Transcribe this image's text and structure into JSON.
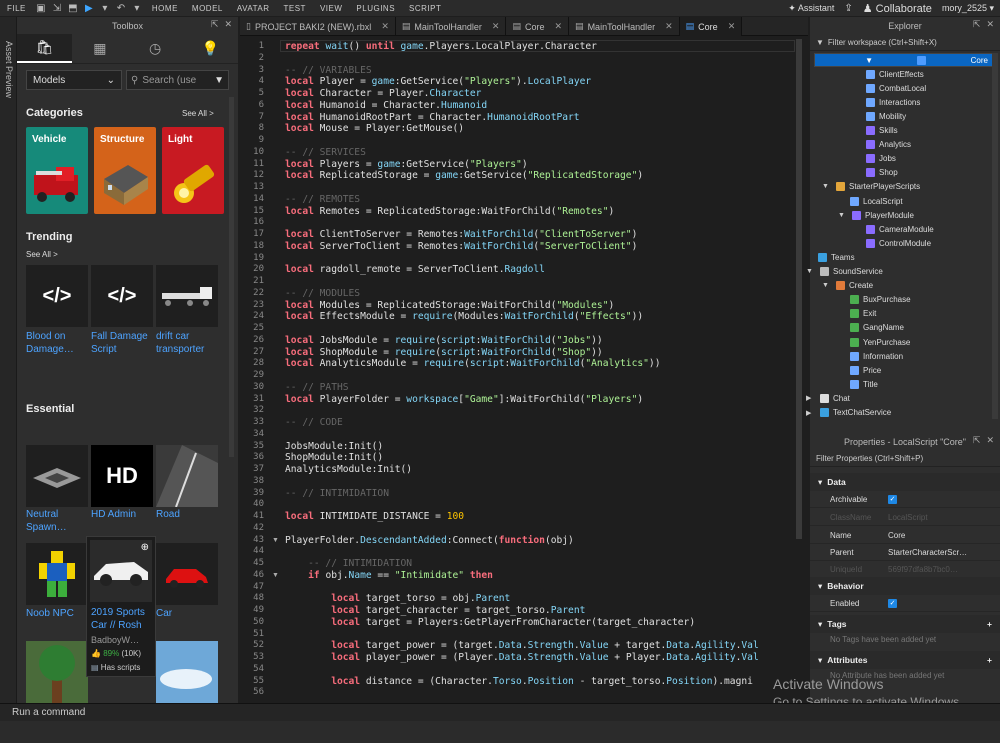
{
  "menubar": {
    "file": "FILE",
    "home": "HOME",
    "model": "MODEL",
    "avatar": "AVATAR",
    "test": "TEST",
    "view": "VIEW",
    "plugins": "PLUGINS",
    "script": "SCRIPT",
    "assistant": "Assistant",
    "collaborate": "Collaborate",
    "username": "mory_2525"
  },
  "toolbox": {
    "title": "Toolbox",
    "asset_preview": "Asset Preview",
    "filter_select": "Models",
    "search_placeholder": "Search (use",
    "categories_heading": "Categories",
    "see_all_categories": "See All >",
    "categories": [
      "Vehicle",
      "Structure",
      "Light"
    ],
    "trending_heading": "Trending",
    "see_all_trending": "See All >",
    "trending": [
      "Blood on Damage…",
      "Fall Damage Script",
      "drift car transporter"
    ],
    "essential_heading": "Essential",
    "essential": [
      "Neutral Spawn…",
      "HD Admin",
      "Road",
      "Noob NPC",
      "",
      "Car"
    ],
    "hd_admin_logo": "HD",
    "tooltip": {
      "name": "2019 Sports Car // Rosh",
      "creator": "BadboyW…",
      "rating": "89%",
      "votes": "(10K)",
      "scripts": "Has scripts"
    }
  },
  "editor": {
    "tabs": [
      {
        "label": "PROJECT BAKI2 (NEW).rbxl",
        "active": false
      },
      {
        "label": "MainToolHandler",
        "active": false
      },
      {
        "label": "Core",
        "active": false
      },
      {
        "label": "MainToolHandler",
        "active": false
      },
      {
        "label": "Core",
        "active": true
      }
    ],
    "lines": [
      {
        "n": "1",
        "t": [
          [
            "k",
            "repeat "
          ],
          [
            "b",
            "wait"
          ],
          [
            "",
            "() "
          ],
          [
            "k",
            "until "
          ],
          [
            "b",
            "game"
          ],
          [
            "",
            ".Players.LocalPlayer.Character"
          ]
        ]
      },
      {
        "n": "2",
        "t": []
      },
      {
        "n": "3",
        "t": [
          [
            "c",
            "-- // VARIABLES"
          ]
        ]
      },
      {
        "n": "4",
        "t": [
          [
            "k",
            "local "
          ],
          [
            "",
            "Player = "
          ],
          [
            "b",
            "game"
          ],
          [
            "",
            ":GetService("
          ],
          [
            "s",
            "\"Players\""
          ],
          [
            "",
            ")."
          ],
          [
            "b",
            "LocalPlayer"
          ]
        ]
      },
      {
        "n": "5",
        "t": [
          [
            "k",
            "local "
          ],
          [
            "",
            "Character = Player."
          ],
          [
            "b",
            "Character"
          ]
        ]
      },
      {
        "n": "6",
        "t": [
          [
            "k",
            "local "
          ],
          [
            "",
            "Humanoid = Character."
          ],
          [
            "b",
            "Humanoid"
          ]
        ]
      },
      {
        "n": "7",
        "t": [
          [
            "k",
            "local "
          ],
          [
            "",
            "HumanoidRootPart = Character."
          ],
          [
            "b",
            "HumanoidRootPart"
          ]
        ]
      },
      {
        "n": "8",
        "t": [
          [
            "k",
            "local "
          ],
          [
            "",
            "Mouse = Player:GetMouse()"
          ]
        ]
      },
      {
        "n": "9",
        "t": []
      },
      {
        "n": "10",
        "t": [
          [
            "c",
            "-- // SERVICES"
          ]
        ]
      },
      {
        "n": "11",
        "t": [
          [
            "k",
            "local "
          ],
          [
            "",
            "Players = "
          ],
          [
            "b",
            "game"
          ],
          [
            "",
            ":GetService("
          ],
          [
            "s",
            "\"Players\""
          ],
          [
            "",
            ")"
          ]
        ]
      },
      {
        "n": "12",
        "t": [
          [
            "k",
            "local "
          ],
          [
            "",
            "ReplicatedStorage = "
          ],
          [
            "b",
            "game"
          ],
          [
            "",
            ":GetService("
          ],
          [
            "s",
            "\"ReplicatedStorage\""
          ],
          [
            "",
            ")"
          ]
        ]
      },
      {
        "n": "13",
        "t": []
      },
      {
        "n": "14",
        "t": [
          [
            "c",
            "-- // REMOTES"
          ]
        ]
      },
      {
        "n": "15",
        "t": [
          [
            "k",
            "local "
          ],
          [
            "",
            "Remotes = ReplicatedStorage:WaitForChild("
          ],
          [
            "s",
            "\"Remotes\""
          ],
          [
            "",
            ")"
          ]
        ]
      },
      {
        "n": "16",
        "t": []
      },
      {
        "n": "17",
        "t": [
          [
            "k",
            "local "
          ],
          [
            "",
            "ClientToServer = Remotes:"
          ],
          [
            "b",
            "WaitForChild"
          ],
          [
            "",
            "("
          ],
          [
            "s",
            "\"ClientToServer\""
          ],
          [
            "",
            ")"
          ]
        ]
      },
      {
        "n": "18",
        "t": [
          [
            "k",
            "local "
          ],
          [
            "",
            "ServerToClient = Remotes:"
          ],
          [
            "b",
            "WaitForChild"
          ],
          [
            "",
            "("
          ],
          [
            "s",
            "\"ServerToClient\""
          ],
          [
            "",
            ")"
          ]
        ]
      },
      {
        "n": "19",
        "t": []
      },
      {
        "n": "20",
        "t": [
          [
            "k",
            "local "
          ],
          [
            "",
            "ragdoll_remote = ServerToClient."
          ],
          [
            "b",
            "Ragdoll"
          ]
        ]
      },
      {
        "n": "21",
        "t": []
      },
      {
        "n": "22",
        "t": [
          [
            "c",
            "-- // MODULES"
          ]
        ]
      },
      {
        "n": "23",
        "t": [
          [
            "k",
            "local "
          ],
          [
            "",
            "Modules = ReplicatedStorage:WaitForChild("
          ],
          [
            "s",
            "\"Modules\""
          ],
          [
            "",
            ")"
          ]
        ]
      },
      {
        "n": "24",
        "t": [
          [
            "k",
            "local "
          ],
          [
            "",
            "EffectsModule = "
          ],
          [
            "b",
            "require"
          ],
          [
            "",
            "(Modules:"
          ],
          [
            "b",
            "WaitForChild"
          ],
          [
            "",
            "("
          ],
          [
            "s",
            "\"Effects\""
          ],
          [
            "",
            "))"
          ]
        ]
      },
      {
        "n": "25",
        "t": []
      },
      {
        "n": "26",
        "t": [
          [
            "k",
            "local "
          ],
          [
            "",
            "JobsModule = "
          ],
          [
            "b",
            "require"
          ],
          [
            "",
            "("
          ],
          [
            "b",
            "script"
          ],
          [
            "",
            ":"
          ],
          [
            "b",
            "WaitForChild"
          ],
          [
            "",
            "("
          ],
          [
            "s",
            "\"Jobs\""
          ],
          [
            "",
            "))"
          ]
        ]
      },
      {
        "n": "27",
        "t": [
          [
            "k",
            "local "
          ],
          [
            "",
            "ShopModule = "
          ],
          [
            "b",
            "require"
          ],
          [
            "",
            "("
          ],
          [
            "b",
            "script"
          ],
          [
            "",
            ":"
          ],
          [
            "b",
            "WaitForChild"
          ],
          [
            "",
            "("
          ],
          [
            "s",
            "\"Shop\""
          ],
          [
            "",
            "))"
          ]
        ]
      },
      {
        "n": "28",
        "t": [
          [
            "k",
            "local "
          ],
          [
            "",
            "AnalyticsModule = "
          ],
          [
            "b",
            "require"
          ],
          [
            "",
            "("
          ],
          [
            "b",
            "script"
          ],
          [
            "",
            ":"
          ],
          [
            "b",
            "WaitForChild"
          ],
          [
            "",
            "("
          ],
          [
            "s",
            "\"Analytics\""
          ],
          [
            "",
            "))"
          ]
        ]
      },
      {
        "n": "29",
        "t": []
      },
      {
        "n": "30",
        "t": [
          [
            "c",
            "-- // PATHS"
          ]
        ]
      },
      {
        "n": "31",
        "t": [
          [
            "k",
            "local "
          ],
          [
            "",
            "PlayerFolder = "
          ],
          [
            "b",
            "workspace"
          ],
          [
            "",
            "["
          ],
          [
            "s",
            "\"Game\""
          ],
          [
            "",
            "]:WaitForChild("
          ],
          [
            "s",
            "\"Players\""
          ],
          [
            "",
            ")"
          ]
        ]
      },
      {
        "n": "32",
        "t": []
      },
      {
        "n": "33",
        "t": [
          [
            "c",
            "-- // CODE"
          ]
        ]
      },
      {
        "n": "34",
        "t": []
      },
      {
        "n": "35",
        "t": [
          [
            "",
            "JobsModule:Init()"
          ]
        ]
      },
      {
        "n": "36",
        "t": [
          [
            "",
            "ShopModule:Init()"
          ]
        ]
      },
      {
        "n": "37",
        "t": [
          [
            "",
            "AnalyticsModule:Init()"
          ]
        ]
      },
      {
        "n": "38",
        "t": []
      },
      {
        "n": "39",
        "t": [
          [
            "c",
            "-- // INTIMIDATION"
          ]
        ]
      },
      {
        "n": "40",
        "t": []
      },
      {
        "n": "41",
        "t": [
          [
            "k",
            "local "
          ],
          [
            "",
            "INTIMIDATE_DISTANCE = "
          ],
          [
            "n",
            "100"
          ]
        ]
      },
      {
        "n": "42",
        "t": []
      },
      {
        "n": "43",
        "t": [
          [
            "",
            "PlayerFolder."
          ],
          [
            "b",
            "DescendantAdded"
          ],
          [
            "",
            ":Connect("
          ],
          [
            "k",
            "function"
          ],
          [
            "",
            "(obj)"
          ]
        ]
      },
      {
        "n": "44",
        "t": []
      },
      {
        "n": "45",
        "t": [
          [
            "c",
            "    -- // INTIMIDATION"
          ]
        ]
      },
      {
        "n": "46",
        "t": [
          [
            "k",
            "    if "
          ],
          [
            "",
            "obj."
          ],
          [
            "b",
            "Name"
          ],
          [
            "",
            " == "
          ],
          [
            "s",
            "\"Intimidate\""
          ],
          [
            "k",
            " then"
          ]
        ]
      },
      {
        "n": "47",
        "t": []
      },
      {
        "n": "48",
        "t": [
          [
            "k",
            "        local "
          ],
          [
            "",
            "target_torso = obj."
          ],
          [
            "b",
            "Parent"
          ]
        ]
      },
      {
        "n": "49",
        "t": [
          [
            "k",
            "        local "
          ],
          [
            "",
            "target_character = target_torso."
          ],
          [
            "b",
            "Parent"
          ]
        ]
      },
      {
        "n": "50",
        "t": [
          [
            "k",
            "        local "
          ],
          [
            "",
            "target = Players:GetPlayerFromCharacter(target_character)"
          ]
        ]
      },
      {
        "n": "51",
        "t": []
      },
      {
        "n": "52",
        "t": [
          [
            "k",
            "        local "
          ],
          [
            "",
            "target_power = (target."
          ],
          [
            "b",
            "Data"
          ],
          [
            "",
            "."
          ],
          [
            "b",
            "Strength"
          ],
          [
            "",
            "."
          ],
          [
            "b",
            "Value"
          ],
          [
            "",
            " + target."
          ],
          [
            "b",
            "Data"
          ],
          [
            "",
            "."
          ],
          [
            "b",
            "Agility"
          ],
          [
            "",
            "."
          ],
          [
            "b",
            "Val"
          ]
        ]
      },
      {
        "n": "53",
        "t": [
          [
            "k",
            "        local "
          ],
          [
            "",
            "player_power = (Player."
          ],
          [
            "b",
            "Data"
          ],
          [
            "",
            "."
          ],
          [
            "b",
            "Strength"
          ],
          [
            "",
            "."
          ],
          [
            "b",
            "Value"
          ],
          [
            "",
            " + Player."
          ],
          [
            "b",
            "Data"
          ],
          [
            "",
            "."
          ],
          [
            "b",
            "Agility"
          ],
          [
            "",
            "."
          ],
          [
            "b",
            "Val"
          ]
        ]
      },
      {
        "n": "54",
        "t": []
      },
      {
        "n": "55",
        "t": [
          [
            "k",
            "        local "
          ],
          [
            "",
            "distance = (Character."
          ],
          [
            "b",
            "Torso"
          ],
          [
            "",
            "."
          ],
          [
            "b",
            "Position"
          ],
          [
            "",
            " - target_torso."
          ],
          [
            "b",
            "Position"
          ],
          [
            "",
            ").magni"
          ]
        ]
      },
      {
        "n": "56",
        "t": []
      }
    ]
  },
  "explorer": {
    "title": "Explorer",
    "filter": "Filter workspace (Ctrl+Shift+X)",
    "items": [
      {
        "label": "Core",
        "depth": 2,
        "color": "#4d9cff",
        "selected": true
      },
      {
        "label": "ClientEffects",
        "depth": 3,
        "color": "#6fa8ff"
      },
      {
        "label": "CombatLocal",
        "depth": 3,
        "color": "#6fa8ff"
      },
      {
        "label": "Interactions",
        "depth": 3,
        "color": "#6fa8ff"
      },
      {
        "label": "Mobility",
        "depth": 3,
        "color": "#6fa8ff"
      },
      {
        "label": "Skills",
        "depth": 3,
        "color": "#8a6cff"
      },
      {
        "label": "Analytics",
        "depth": 3,
        "color": "#8a6cff"
      },
      {
        "label": "Jobs",
        "depth": 3,
        "color": "#8a6cff"
      },
      {
        "label": "Shop",
        "depth": 3,
        "color": "#8a6cff"
      },
      {
        "label": "StarterPlayerScripts",
        "depth": 1,
        "color": "#e3a63b"
      },
      {
        "label": "LocalScript",
        "depth": 2,
        "color": "#6fa8ff"
      },
      {
        "label": "PlayerModule",
        "depth": 2,
        "color": "#8a6cff"
      },
      {
        "label": "CameraModule",
        "depth": 3,
        "color": "#8a6cff"
      },
      {
        "label": "ControlModule",
        "depth": 3,
        "color": "#8a6cff"
      },
      {
        "label": "Teams",
        "depth": 0,
        "color": "#3aa0e0"
      },
      {
        "label": "SoundService",
        "depth": 0,
        "color": "#bbbbbb"
      },
      {
        "label": "Create",
        "depth": 1,
        "color": "#e07a3a"
      },
      {
        "label": "BuxPurchase",
        "depth": 2,
        "color": "#4caf50"
      },
      {
        "label": "Exit",
        "depth": 2,
        "color": "#4caf50"
      },
      {
        "label": "GangName",
        "depth": 2,
        "color": "#4caf50"
      },
      {
        "label": "YenPurchase",
        "depth": 2,
        "color": "#4caf50"
      },
      {
        "label": "Information",
        "depth": 2,
        "color": "#6fa8ff"
      },
      {
        "label": "Price",
        "depth": 2,
        "color": "#6fa8ff"
      },
      {
        "label": "Title",
        "depth": 2,
        "color": "#6fa8ff"
      },
      {
        "label": "Chat",
        "depth": 0,
        "color": "#dddddd"
      },
      {
        "label": "TextChatService",
        "depth": 0,
        "color": "#3aa0e0"
      }
    ]
  },
  "properties": {
    "title": "Properties - LocalScript \"Core\"",
    "filter": "Filter Properties (Ctrl+Shift+P)",
    "cat_data": "Data",
    "archivable": "Archivable",
    "classname_k": "ClassName",
    "classname_v": "LocalScript",
    "name_k": "Name",
    "name_v": "Core",
    "parent_k": "Parent",
    "parent_v": "StarterCharacterScr…",
    "uniqueid_k": "UniqueId",
    "uniqueid_v": "569f97dfa8b7bc0…",
    "cat_behavior": "Behavior",
    "enabled": "Enabled",
    "cat_tags": "Tags",
    "tags_empty": "No Tags have been added yet",
    "cat_attributes": "Attributes",
    "attr_empty": "No Attribute has been added yet"
  },
  "command": {
    "placeholder": "Run a command"
  },
  "watermark": {
    "line1": "Activate Windows",
    "line2": "Go to Settings to activate Windows."
  }
}
